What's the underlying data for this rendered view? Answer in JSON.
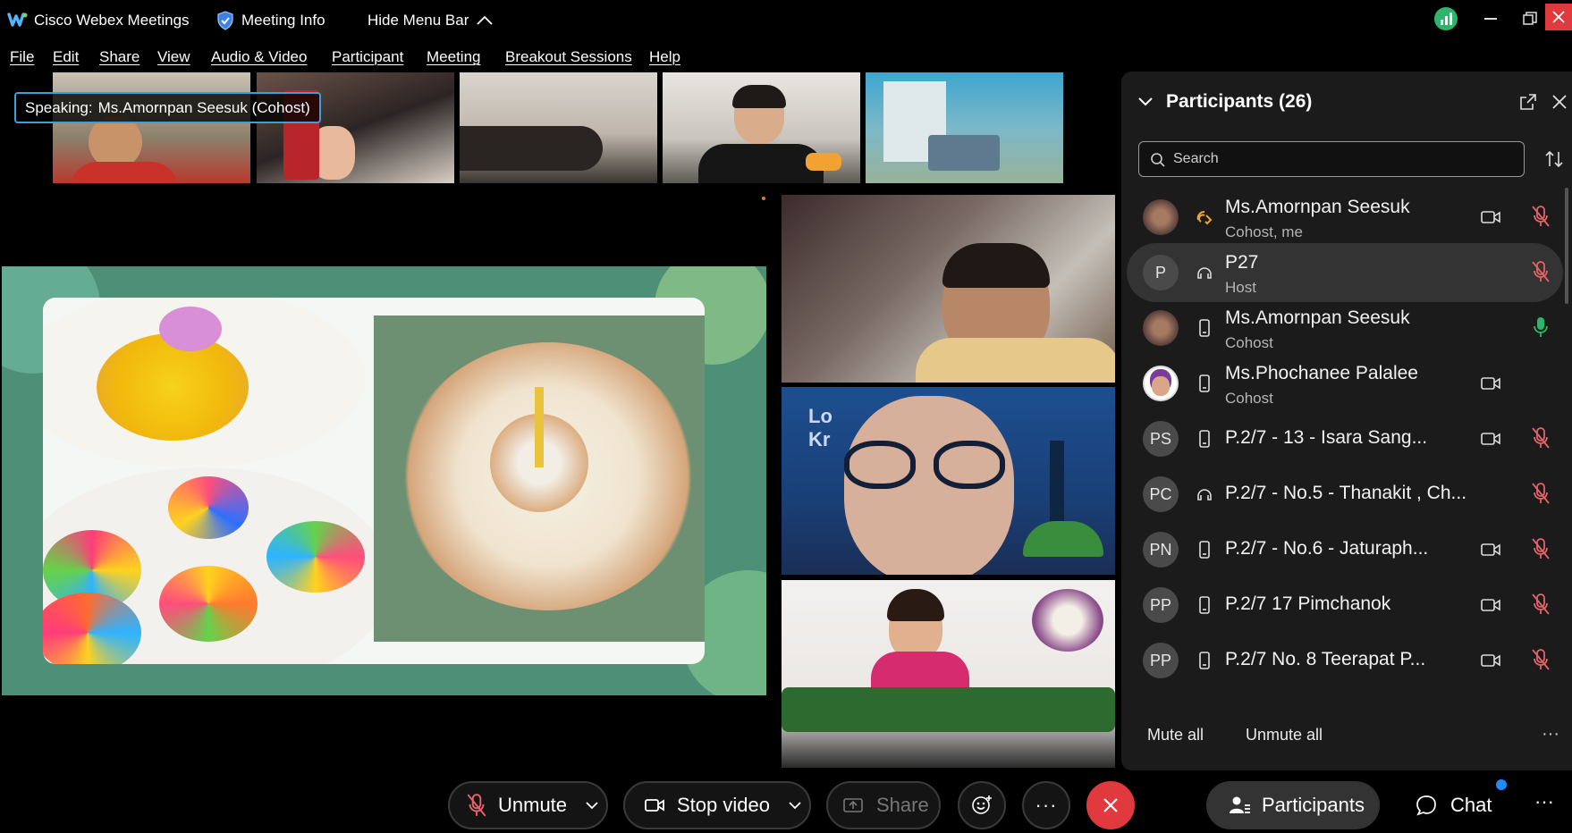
{
  "app": {
    "name": "Cisco Webex Meetings",
    "meeting_info": "Meeting Info",
    "hide_menu": "Hide Menu Bar"
  },
  "menu": [
    "File",
    "Edit",
    "Share",
    "View",
    "Audio & Video",
    "Participant",
    "Meeting",
    "Breakout Sessions",
    "Help"
  ],
  "speaking": {
    "label": "Speaking:",
    "name": "Ms.Amornpan Seesuk (Cohost)"
  },
  "panel": {
    "title": "Participants (26)",
    "search_placeholder": "Search",
    "participants": [
      {
        "initials": "",
        "name": "Ms.Amornpan Seesuk",
        "role": "Cohost, me",
        "device": "audio-orange",
        "cam": true,
        "mic": "muted"
      },
      {
        "initials": "P",
        "name": "P27",
        "role": "Host",
        "device": "headset",
        "cam": false,
        "mic": "muted"
      },
      {
        "initials": "",
        "name": "Ms.Amornpan Seesuk",
        "role": "Cohost",
        "device": "phone",
        "cam": false,
        "mic": "on"
      },
      {
        "initials": "",
        "name": "Ms.Phochanee Palalee",
        "role": "Cohost",
        "device": "phone",
        "cam": true,
        "mic": "none"
      },
      {
        "initials": "PS",
        "name": "P.2/7 - 13 - Isara Sang...",
        "role": "",
        "device": "phone",
        "cam": true,
        "mic": "muted"
      },
      {
        "initials": "PC",
        "name": "P.2/7 - No.5 - Thanakit , Ch...",
        "role": "",
        "device": "headset",
        "cam": false,
        "mic": "muted"
      },
      {
        "initials": "PN",
        "name": "P.2/7 - No.6 - Jaturaph...",
        "role": "",
        "device": "phone",
        "cam": true,
        "mic": "muted"
      },
      {
        "initials": "PP",
        "name": "P.2/7 17 Pimchanok",
        "role": "",
        "device": "phone",
        "cam": true,
        "mic": "muted"
      },
      {
        "initials": "PP",
        "name": "P.2/7 No. 8 Teerapat P...",
        "role": "",
        "device": "phone",
        "cam": true,
        "mic": "muted"
      }
    ],
    "mute_all": "Mute all",
    "unmute_all": "Unmute all"
  },
  "controls": {
    "unmute": "Unmute",
    "stop_video": "Stop video",
    "share": "Share",
    "participants": "Participants",
    "chat": "Chat"
  },
  "colors": {
    "accent_blue": "#3aa0d8",
    "end_red": "#e0393e",
    "muted_red": "#e4646a",
    "mic_green": "#2fb56b"
  }
}
